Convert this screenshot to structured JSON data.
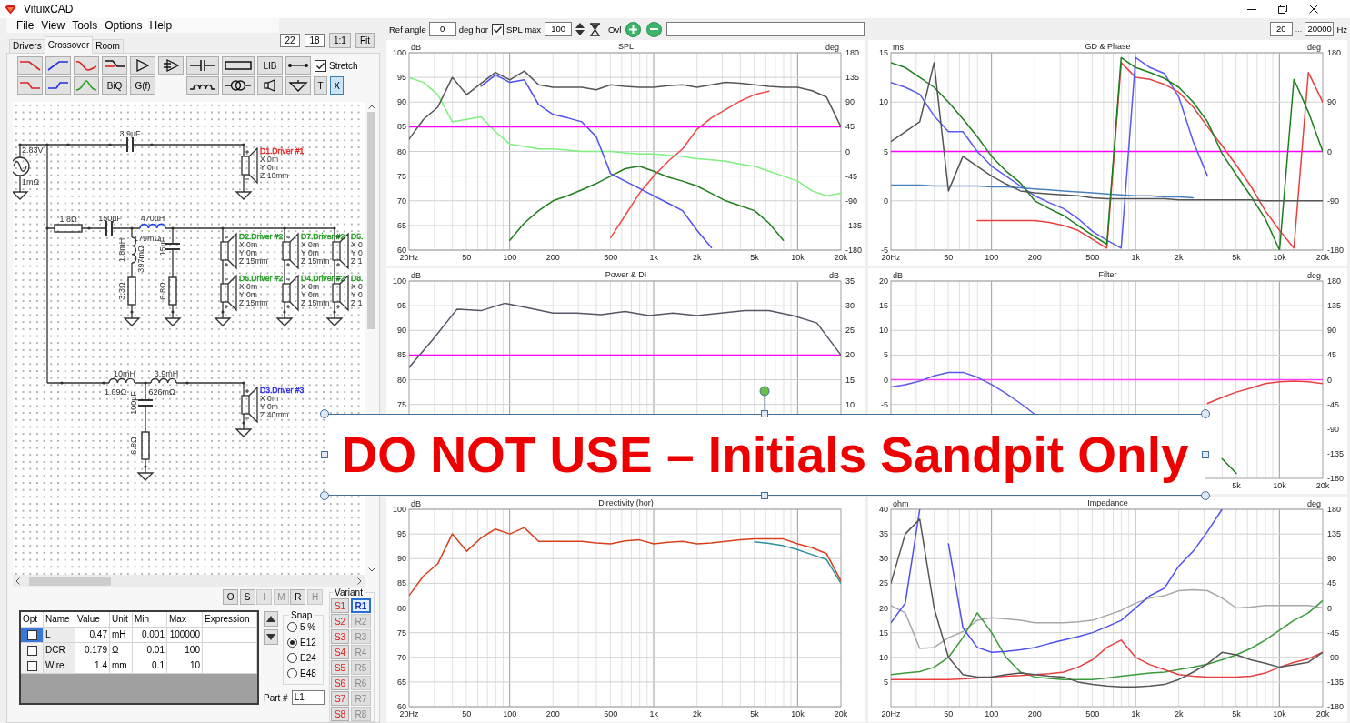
{
  "window": {
    "title": "VituixCAD"
  },
  "menu": [
    "File",
    "View",
    "Tools",
    "Options",
    "Help"
  ],
  "view_controls": {
    "fields": [
      "22",
      "18"
    ],
    "buttons": [
      "1:1",
      "Fit"
    ]
  },
  "tabs": [
    {
      "label": "Drivers",
      "selected": false
    },
    {
      "label": "Crossover",
      "selected": true
    },
    {
      "label": "Room",
      "selected": false
    }
  ],
  "tool_rows": [
    [
      {
        "kind": "lowpass"
      },
      {
        "kind": "highpass"
      },
      {
        "kind": "allpass"
      },
      {
        "kind": "shelf"
      },
      {
        "kind": "amplifier"
      },
      {
        "kind": "buffer"
      },
      {
        "kind": "capacitor"
      },
      {
        "kind": "resistor"
      },
      {
        "kind": "text",
        "label": "LIB"
      },
      {
        "kind": "wire"
      }
    ],
    [
      {
        "kind": "lowpass_step"
      },
      {
        "kind": "highpass_step"
      },
      {
        "kind": "bandpass"
      },
      {
        "kind": "text",
        "label": "BiQ"
      },
      {
        "kind": "text",
        "label": "G(f)"
      },
      {
        "kind": "inductor"
      },
      {
        "kind": "transformer"
      },
      {
        "kind": "speaker"
      },
      {
        "kind": "ground"
      },
      {
        "kind": "toggle",
        "label": "T",
        "pressed": false
      },
      {
        "kind": "toggle",
        "label": "X",
        "pressed": true
      }
    ]
  ],
  "stretch": {
    "label": "Stretch",
    "checked": true
  },
  "schematic": {
    "source": {
      "voltage": "2.83V",
      "resistance": "1mΩ"
    },
    "parts": [
      {
        "kind": "capacitor",
        "labels": [
          "3.9µF"
        ],
        "selected": false
      },
      {
        "kind": "resistor",
        "labels": [
          "1.8Ω"
        ],
        "selected": false
      },
      {
        "kind": "capacitor",
        "labels": [
          "150µF"
        ],
        "selected": false
      },
      {
        "kind": "inductor",
        "labels": [
          "470µH",
          "179mΩ"
        ],
        "selected": true
      },
      {
        "kind": "inductor",
        "labels": [
          "1.8mH",
          "397mΩ"
        ],
        "selected": false
      },
      {
        "kind": "resistor",
        "labels": [
          "3.3Ω"
        ],
        "selected": false
      },
      {
        "kind": "capacitor",
        "labels": [
          "15µF"
        ],
        "selected": false
      },
      {
        "kind": "resistor",
        "labels": [
          "6.8Ω"
        ],
        "selected": false
      },
      {
        "kind": "inductor",
        "labels": [
          "10mH",
          "1.09Ω"
        ],
        "selected": false
      },
      {
        "kind": "inductor",
        "labels": [
          "3.9mH",
          "626mΩ"
        ],
        "selected": false
      },
      {
        "kind": "capacitor",
        "labels": [
          "100µF"
        ],
        "selected": false
      },
      {
        "kind": "resistor",
        "labels": [
          "6.8Ω"
        ],
        "selected": false
      }
    ],
    "drivers": [
      {
        "name": "D1.Driver #1",
        "color": "#f02828",
        "inverted": false,
        "position": [
          "X 0m",
          "Y 0m",
          "Z 10mm"
        ]
      },
      {
        "name": "D2.Driver #2",
        "color": "#28a028",
        "inverted": true,
        "position": [
          "X 0m",
          "Y 0m",
          "Z 15mm"
        ]
      },
      {
        "name": "D7.Driver #2",
        "color": "#28a028",
        "inverted": true,
        "position": [
          "X 0m",
          "Y 0m",
          "Z 15mm"
        ]
      },
      {
        "name": "D5.",
        "color": "#28a028",
        "inverted": true,
        "position": [
          "X 0",
          "Y 0",
          "Z 1"
        ]
      },
      {
        "name": "D6.Driver #2",
        "color": "#28a028",
        "inverted": true,
        "position": [
          "X 0m",
          "Y 0m",
          "Z 15mm"
        ]
      },
      {
        "name": "D4.Driver #2",
        "color": "#28a028",
        "inverted": true,
        "position": [
          "X 0m",
          "Y 0m",
          "Z 15mm"
        ]
      },
      {
        "name": "D8.",
        "color": "#28a028",
        "inverted": true,
        "position": [
          "X 0",
          "Y 0",
          "Z 1"
        ]
      },
      {
        "name": "D3.Driver #3",
        "color": "#3030f0",
        "inverted": false,
        "position": [
          "X 0m",
          "Y 0m",
          "Z 40mm"
        ]
      }
    ]
  },
  "part_buttons": [
    {
      "label": "O",
      "disabled": false
    },
    {
      "label": "S",
      "disabled": false
    },
    {
      "label": "I",
      "disabled": true
    },
    {
      "label": "M",
      "disabled": true
    },
    {
      "label": "R",
      "disabled": false
    },
    {
      "label": "H",
      "disabled": true
    }
  ],
  "parameter_table": {
    "columns": [
      "Opt",
      "Name",
      "Value",
      "Unit",
      "Min",
      "Max",
      "Expression"
    ],
    "rows": [
      {
        "selected": true,
        "opt": false,
        "name": "L",
        "value": "0.47",
        "unit": "mH",
        "min": "0.001",
        "max": "100000"
      },
      {
        "selected": false,
        "opt": false,
        "name": "DCR",
        "value": "0.179",
        "unit": "Ω",
        "min": "0.01",
        "max": "100"
      },
      {
        "selected": false,
        "opt": false,
        "name": "Wire",
        "value": "1.4",
        "unit": "mm",
        "min": "0.1",
        "max": "10"
      }
    ]
  },
  "snap": {
    "title": "Snap",
    "options": [
      {
        "label": "5 %",
        "selected": false
      },
      {
        "label": "E12",
        "selected": true
      },
      {
        "label": "E24",
        "selected": false
      },
      {
        "label": "E48",
        "selected": false
      }
    ]
  },
  "part_number": {
    "label": "Part #",
    "value": "L1"
  },
  "variant": {
    "title": "Variant",
    "snapshots": [
      "S1",
      "S2",
      "S3",
      "S4",
      "S5",
      "S6",
      "S7",
      "S8"
    ],
    "recalls": [
      {
        "label": "R1",
        "selected": true,
        "disabled": false
      },
      {
        "label": "R2",
        "selected": false,
        "disabled": true
      },
      {
        "label": "R3",
        "selected": false,
        "disabled": true
      },
      {
        "label": "R4",
        "selected": false,
        "disabled": true
      },
      {
        "label": "R5",
        "selected": false,
        "disabled": true
      },
      {
        "label": "R6",
        "selected": false,
        "disabled": true
      },
      {
        "label": "R7",
        "selected": false,
        "disabled": true
      },
      {
        "label": "R8",
        "selected": false,
        "disabled": true
      }
    ]
  },
  "chart_toolbar": {
    "ref_angle": {
      "label": "Ref angle",
      "value": "0",
      "unit": "deg hor"
    },
    "spl_max": {
      "label": "SPL max",
      "checked": true,
      "value": "100"
    },
    "overlay_label": "Ovl"
  },
  "frequency_range": {
    "from": "20",
    "separator": "...",
    "to": "20000",
    "unit": "Hz"
  },
  "panels": [
    {
      "chart_data": {
        "type": "line",
        "title": "SPL",
        "ylabel": "dB",
        "y2label": "deg",
        "grid": true,
        "categories": [
          "20Hz",
          null,
          null,
          null,
          "50",
          null,
          null,
          "100",
          null,
          null,
          "200",
          null,
          null,
          null,
          "500",
          null,
          null,
          "1k",
          null,
          null,
          "2k",
          null,
          null,
          null,
          "5k",
          null,
          null,
          "10k",
          null,
          null,
          "20k"
        ],
        "ylim": [
          60,
          100
        ],
        "y2lim": [
          -180,
          180
        ],
        "yticks": [
          100,
          95,
          90,
          85,
          80,
          75,
          70,
          65,
          60
        ],
        "y2ticks": [
          180,
          135,
          90,
          45,
          0,
          -45,
          -90,
          -135,
          -180
        ],
        "series": [
          {
            "color": "#7ef07e",
            "values": [
              95,
              94,
              91.5,
              86,
              86.5,
              87,
              84,
              81.5,
              81,
              80.5,
              80.5,
              80.3,
              80,
              80,
              80,
              79.7,
              79.5,
              79.5,
              79.2,
              79,
              78.5,
              78.3,
              78,
              77.4,
              77,
              76,
              75,
              74,
              72,
              71,
              71.5
            ]
          },
          {
            "color": "#1e7e1e",
            "values": [
              null,
              null,
              null,
              null,
              null,
              null,
              null,
              62,
              65.5,
              68,
              70,
              71,
              72.2,
              73.5,
              75,
              76.5,
              77,
              76,
              74.8,
              74,
              73,
              71.5,
              70,
              69,
              68,
              65.5,
              62,
              null,
              null,
              null,
              null
            ]
          },
          {
            "color": "#f04848",
            "values": [
              null,
              null,
              null,
              null,
              null,
              null,
              null,
              null,
              null,
              null,
              null,
              null,
              null,
              null,
              62.5,
              67,
              71.5,
              75,
              78,
              80.5,
              84.5,
              86.8,
              88.5,
              90.2,
              91.5,
              92.2,
              null,
              null,
              null,
              null,
              null
            ]
          },
          {
            "color": "#4f4ff0",
            "values": [
              null,
              null,
              null,
              null,
              null,
              93.2,
              95.5,
              94,
              94.5,
              89.5,
              87.5,
              86.8,
              86,
              83,
              75.5,
              74,
              72.5,
              71,
              69.5,
              68,
              64,
              60.5,
              null,
              null,
              null,
              null,
              null,
              null,
              null,
              null,
              null
            ]
          },
          {
            "color": "#ff00ff",
            "values": [
              85,
              85,
              85,
              85,
              85,
              85,
              85,
              85,
              85,
              85,
              85,
              85,
              85,
              85,
              85,
              85,
              85,
              85,
              85,
              85,
              85,
              85,
              85,
              85,
              85,
              85,
              85,
              85,
              85,
              85,
              85
            ]
          },
          {
            "color": "#555555",
            "values": [
              82.5,
              86.5,
              89,
              95,
              91.5,
              93.8,
              96,
              94.5,
              96.3,
              93.5,
              93,
              93,
              93,
              92.5,
              93.5,
              93.2,
              93,
              93,
              93.3,
              93.5,
              93,
              93.5,
              94,
              93.8,
              93.5,
              93.2,
              93,
              93,
              92.3,
              91,
              85
            ]
          }
        ]
      }
    },
    {
      "chart_data": {
        "type": "line",
        "title": "GD & Phase",
        "ylabel": "ms",
        "y2label": "deg",
        "grid": true,
        "categories": [
          "20Hz",
          null,
          null,
          null,
          "50",
          null,
          null,
          "100",
          null,
          null,
          "200",
          null,
          null,
          null,
          "500",
          null,
          null,
          "1k",
          null,
          null,
          "2k",
          null,
          null,
          null,
          "5k",
          null,
          null,
          "10k",
          null,
          null,
          "20k"
        ],
        "ylim": [
          -5,
          15
        ],
        "y2lim": [
          -180,
          180
        ],
        "yticks": [
          15,
          10,
          5,
          0,
          -5
        ],
        "y2ticks": [
          180,
          90,
          0,
          -90,
          -180
        ],
        "series": [
          {
            "color": "#ff00ff",
            "values": [
              5,
              5,
              5,
              5,
              5,
              5,
              5,
              5,
              5,
              5,
              5,
              5,
              5,
              5,
              5,
              5,
              5,
              5,
              5,
              5,
              5,
              5,
              5,
              5,
              5,
              5,
              5,
              5,
              5,
              5,
              5
            ]
          },
          {
            "color": "#4a80c0",
            "values": [
              1.6,
              1.6,
              1.6,
              1.5,
              1.5,
              1.5,
              1.5,
              1.4,
              1.4,
              1.3,
              1.2,
              1.1,
              1,
              0.9,
              0.8,
              0.7,
              0.6,
              0.5,
              0.5,
              0.4,
              0.4,
              0.3,
              null,
              null,
              null,
              null,
              null,
              null,
              null,
              null,
              null
            ]
          },
          {
            "color": "#e84040",
            "values": [
              null,
              null,
              null,
              null,
              null,
              null,
              -2,
              -2,
              -2,
              -2,
              -2,
              -2.2,
              -2.5,
              -3,
              -3.9,
              -4.8,
              14,
              12.5,
              12.3,
              11.8,
              11,
              9.5,
              7.5,
              5.6,
              3.6,
              1.5,
              -1,
              -3,
              -4.8,
              13,
              10
            ]
          },
          {
            "color": "#5a5af0",
            "values": [
              12,
              11.5,
              10.8,
              8.6,
              7,
              7,
              5,
              3.5,
              2.5,
              1.5,
              0.5,
              -0.2,
              -0.8,
              -1.8,
              -3.1,
              -4,
              -4.8,
              14.5,
              13.5,
              12.9,
              10.5,
              6,
              2.5,
              null,
              null,
              null,
              null,
              null,
              null,
              null,
              null
            ]
          },
          {
            "color": "#1e7e1e",
            "values": [
              14,
              13.5,
              12.5,
              11.5,
              10,
              8.3,
              6.5,
              4.5,
              3,
              1.8,
              0,
              -0.8,
              -1.5,
              -2.5,
              -3.5,
              -4.4,
              14.5,
              13.5,
              13,
              12.4,
              11.5,
              10,
              8,
              4.8,
              2.6,
              0.5,
              -1.8,
              -5,
              12.3,
              9,
              5
            ]
          },
          {
            "color": "#555555",
            "values": [
              6,
              7,
              8,
              14,
              1,
              4.5,
              3.5,
              2.5,
              1.7,
              1,
              0.8,
              0.7,
              0.6,
              0.5,
              0.3,
              0.2,
              0.2,
              0.2,
              0.2,
              0.2,
              0.1,
              0.1,
              0.1,
              0.1,
              0.1,
              0.1,
              0,
              0,
              0,
              0,
              0
            ]
          }
        ]
      }
    },
    {
      "chart_data": {
        "type": "line",
        "title": "Power & DI",
        "ylabel": "dB",
        "y2label": "dB",
        "grid": true,
        "ylim": [
          60,
          100
        ],
        "y2lim": [
          -5,
          35
        ],
        "yticks": [
          100,
          95,
          90,
          85,
          80,
          75
        ],
        "y2ticks": [
          35,
          30,
          25,
          20,
          15,
          10
        ],
        "series": [
          {
            "color": "#ff00ff",
            "values": [
              85,
              85,
              85,
              85,
              85,
              85,
              85,
              85,
              85,
              85,
              85,
              85,
              85,
              85,
              85,
              85,
              85,
              85,
              85
            ]
          },
          {
            "color": "#555566",
            "values": [
              82.5,
              88.2,
              94.3,
              94,
              95.5,
              94.5,
              93.5,
              93.5,
              93.2,
              93.8,
              93,
              93.5,
              93,
              93.5,
              94,
              94,
              93,
              91.5,
              85
            ]
          }
        ]
      }
    },
    {
      "chart_data": {
        "type": "line",
        "title": "Filter",
        "ylabel": "dB",
        "y2label": "deg",
        "grid": true,
        "categories": [
          null,
          null,
          null,
          null,
          null,
          null,
          null,
          null,
          null,
          null,
          null,
          null,
          null,
          null,
          null,
          null,
          null,
          null,
          null,
          null,
          null,
          null,
          null,
          null,
          "5k",
          null,
          null,
          "10k",
          null,
          null,
          "20k"
        ],
        "ylim": [
          -20,
          20
        ],
        "y2lim": [
          -180,
          180
        ],
        "yticks": [
          20,
          15,
          10,
          5,
          0,
          -5
        ],
        "y2ticks": [
          180,
          135,
          90,
          45,
          0,
          -45,
          -90,
          -135,
          -180
        ],
        "series": [
          {
            "color": "#ff40ff",
            "values": [
              0,
              0,
              0,
              0,
              0,
              0,
              0,
              0,
              0,
              0,
              0,
              0,
              0,
              0,
              0,
              0,
              0,
              0,
              0,
              0,
              0,
              0,
              0,
              0,
              0,
              0,
              0,
              0,
              0,
              0,
              0
            ]
          },
          {
            "color": "#5a5af0",
            "values": [
              -1.5,
              -1,
              -0.3,
              0.8,
              1.5,
              1.5,
              0.5,
              -1,
              -2.8,
              -4.8,
              -7,
              null,
              null,
              null,
              null,
              null,
              null,
              null,
              null,
              null,
              null,
              null,
              null,
              null,
              null,
              null,
              null,
              null,
              null,
              null,
              null
            ]
          },
          {
            "color": "#e84040",
            "values": [
              null,
              null,
              null,
              null,
              null,
              null,
              null,
              null,
              null,
              null,
              null,
              null,
              null,
              null,
              null,
              null,
              null,
              null,
              null,
              null,
              null,
              null,
              -4.8,
              -3.6,
              -2.5,
              -1.7,
              -0.8,
              -0.4,
              -0.3,
              -0.4,
              -0.8
            ]
          },
          {
            "color": "#1e7e1e",
            "values": [
              null,
              null,
              null,
              null,
              null,
              null,
              null,
              null,
              null,
              null,
              null,
              null,
              null,
              null,
              null,
              null,
              null,
              null,
              null,
              null,
              null,
              null,
              null,
              -16,
              -19,
              null,
              null,
              null,
              null,
              null,
              null
            ]
          }
        ]
      }
    },
    {
      "chart_data": {
        "type": "line",
        "title": "Directivity (hor)",
        "ylabel": "dB",
        "grid": true,
        "categories": [
          "20Hz",
          null,
          null,
          null,
          "50",
          null,
          null,
          "100",
          null,
          null,
          "200",
          null,
          null,
          null,
          "500",
          null,
          null,
          "1k",
          null,
          null,
          "2k",
          null,
          null,
          null,
          "5k",
          null,
          null,
          "10k",
          null,
          null,
          "20k"
        ],
        "ylim": [
          60,
          100
        ],
        "yticks": [
          100,
          95,
          90,
          85,
          80,
          75,
          70,
          65,
          60
        ],
        "series": [
          {
            "color": "#2f8f9f",
            "values": [
              null,
              null,
              null,
              null,
              null,
              null,
              null,
              null,
              null,
              null,
              null,
              null,
              null,
              null,
              null,
              null,
              null,
              null,
              null,
              null,
              null,
              null,
              null,
              null,
              93.4,
              93.1,
              92.6,
              91.8,
              90.8,
              89.8,
              85
            ]
          },
          {
            "color": "#d8401a",
            "values": [
              82.5,
              86.5,
              89,
              95,
              91.5,
              94.2,
              96,
              95,
              96.3,
              93.5,
              93.5,
              93.5,
              93.5,
              93.2,
              93,
              93.6,
              93.8,
              93,
              93.3,
              93.5,
              93,
              93.2,
              93.5,
              93.8,
              94,
              94,
              94,
              93,
              92.2,
              91,
              85.5
            ]
          }
        ]
      }
    },
    {
      "chart_data": {
        "type": "line",
        "title": "Impedance",
        "ylabel": "ohm",
        "y2label": "deg",
        "grid": true,
        "categories": [
          "20Hz",
          null,
          null,
          null,
          "50",
          null,
          null,
          "100",
          null,
          null,
          "200",
          null,
          null,
          null,
          "500",
          null,
          null,
          "1k",
          null,
          null,
          "2k",
          null,
          null,
          null,
          "5k",
          null,
          null,
          "10k",
          null,
          null,
          "20k"
        ],
        "ylim": [
          0,
          40
        ],
        "y2lim": [
          -180,
          180
        ],
        "yticks": [
          40,
          35,
          30,
          25,
          20,
          15,
          10,
          5
        ],
        "y2ticks": [
          180,
          135,
          90,
          45,
          0,
          -45,
          -90,
          -135,
          -180
        ],
        "series": [
          {
            "color": "#a8a8a8",
            "values": [
              20.5,
              19,
              11.8,
              12,
              14,
              15.2,
              17.5,
              18,
              17.8,
              17.5,
              17,
              17,
              17,
              17.2,
              17.5,
              18.5,
              19.5,
              21,
              22,
              22.5,
              23.5,
              23.7,
              23.5,
              22,
              20,
              20.2,
              20.5,
              20.5,
              20.5,
              20.5,
              20
            ]
          },
          {
            "color": "#3a9a3a",
            "values": [
              6.5,
              6.8,
              7.1,
              8,
              10,
              14,
              19,
              15,
              10,
              7,
              6,
              5.7,
              5.5,
              5.5,
              5.5,
              5.8,
              6.2,
              6.5,
              6.8,
              7,
              7.5,
              8,
              8.6,
              9.5,
              10.5,
              11.8,
              13.5,
              15.5,
              17.5,
              19,
              21.5
            ]
          },
          {
            "color": "#e84040",
            "values": [
              5.5,
              5.5,
              5.5,
              5.5,
              5.5,
              5.6,
              5.8,
              6,
              6.2,
              6.3,
              6.5,
              6.7,
              7,
              8,
              9.5,
              12,
              13.5,
              10,
              8.5,
              7.5,
              6.5,
              6.2,
              6,
              6,
              6,
              6.2,
              6.8,
              8,
              9,
              9.7,
              11
            ]
          },
          {
            "color": "#4f4ff0",
            "values": [
              17,
              21,
              40,
              null,
              33,
              16,
              12,
              11,
              11.2,
              11.5,
              12,
              12.8,
              13.5,
              14.2,
              15,
              16.2,
              17.5,
              20,
              22.5,
              24,
              28.5,
              31.5,
              35.5,
              40,
              null,
              null,
              null,
              null,
              null,
              null,
              null
            ]
          },
          {
            "color": "#555555",
            "values": [
              25,
              35,
              38,
              20,
              10,
              6.5,
              6,
              6,
              6.5,
              6.8,
              6.5,
              6.2,
              6,
              5,
              4.5,
              4.2,
              4,
              4,
              4.2,
              4.5,
              5.5,
              7,
              8.7,
              11,
              10.5,
              9.5,
              8.8,
              8,
              8.5,
              9,
              11
            ]
          }
        ]
      }
    }
  ],
  "overlay_note": {
    "text": "DO NOT USE – Initials Sandpit Only"
  }
}
